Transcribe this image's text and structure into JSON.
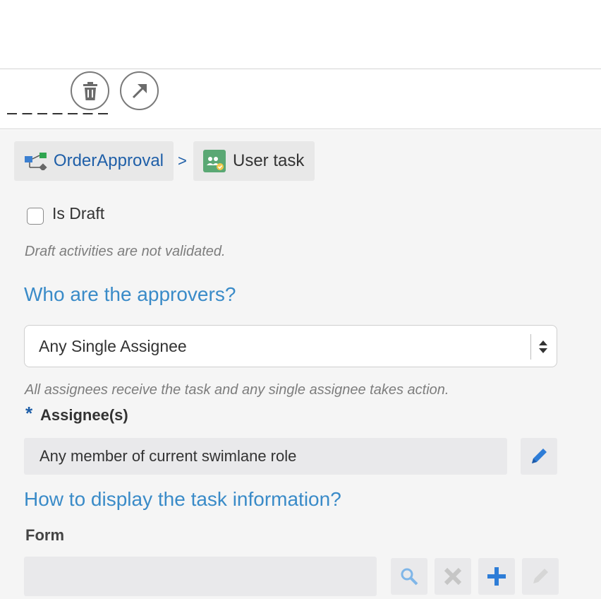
{
  "breadcrumb": {
    "process_label": "OrderApproval",
    "separator": ">",
    "task_label": "User task"
  },
  "draft": {
    "checkbox_label": "Is Draft",
    "checked": false,
    "hint": "Draft activities are not validated."
  },
  "approvers": {
    "heading": "Who are the approvers?",
    "select_value": "Any Single Assignee",
    "hint": "All assignees receive the task and any single assignee takes action."
  },
  "assignees": {
    "required_mark": "*",
    "label": "Assignee(s)",
    "value": "Any member of current swimlane role"
  },
  "display": {
    "heading": "How to display the task information?",
    "form_label": "Form",
    "form_value": ""
  },
  "icons": {
    "delete": "trash-icon",
    "navigate": "arrow-up-right-icon",
    "edit": "pencil-icon",
    "search": "search-icon",
    "clear": "close-icon",
    "add": "plus-icon"
  },
  "colors": {
    "link": "#1f5fa8",
    "heading": "#3a8bc8",
    "panel_bg": "#f5f5f5"
  }
}
